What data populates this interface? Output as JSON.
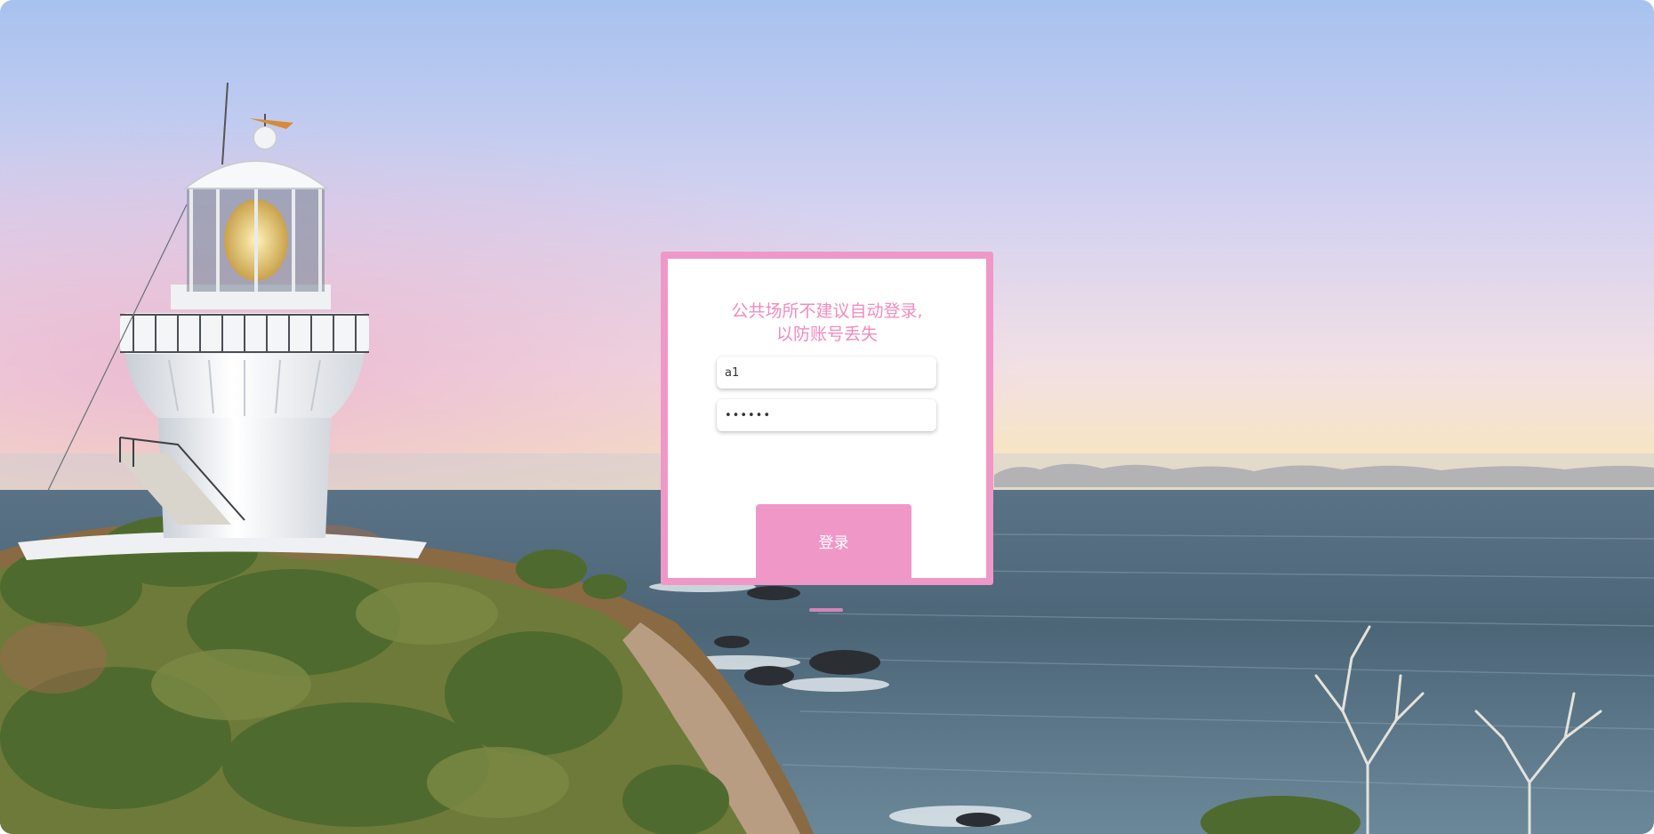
{
  "login": {
    "notice_line1": "公共场所不建议自动登录,",
    "notice_line2": "以防账号丢失",
    "username_value": "a1",
    "password_value": "••••••",
    "submit_label": "登录"
  },
  "colors": {
    "accent": "#ef98c8",
    "title_text": "#ef8cc0",
    "sky_top": "#a9c4ef",
    "sky_pink": "#e8c3dc",
    "sky_horizon": "#f7e6b4",
    "sea": "#44606f"
  },
  "background": {
    "scene": "lighthouse-on-cliff-by-sea"
  }
}
